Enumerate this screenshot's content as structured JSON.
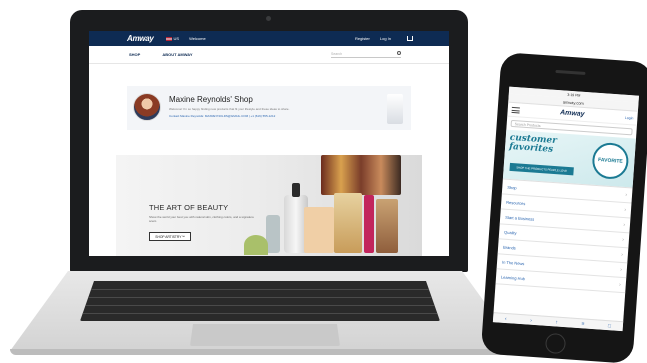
{
  "laptop": {
    "topbar": {
      "logo": "Amway",
      "region": "US",
      "welcome": "Welcome",
      "register": "Register",
      "login": "Log In"
    },
    "nav": {
      "shop": "SHOP",
      "about": "ABOUT AMWAY",
      "search_placeholder": "Search"
    },
    "shop_card": {
      "title": "Maxine Reynolds' Shop",
      "description": "Welcome! I'm so happy finding new products that fit your lifestyle and these ideas to share.",
      "contact": "Contact Maxine Reynolds: MAXREYNOLDS@GMAIL.COM | +1 (616) 555-1212"
    },
    "hero": {
      "title": "THE ART OF BEAUTY",
      "description": "Show the world your best you with natural skin, clothing colors, and a signature scent.",
      "button": "SHOP ARTISTRY™"
    }
  },
  "phone": {
    "status": "3:19 PM",
    "url": "amway.com",
    "logo": "Amway",
    "login": "Login",
    "search_placeholder": "Search Products",
    "banner": {
      "title": "customer favorites",
      "subtitle": "SHOP THE PRODUCTS PEOPLE LOVE",
      "badge": "FAVORITE"
    },
    "menu": [
      "Shop",
      "Resources",
      "Start a Business",
      "Quality",
      "Brands",
      "In The News",
      "Learning Hub"
    ],
    "toolbar": [
      "‹",
      "›",
      "↑",
      "≡",
      "□"
    ]
  },
  "colors": {
    "brand_navy": "#0e2b53",
    "link_blue": "#2b66b0",
    "teal": "#1b7a93"
  }
}
